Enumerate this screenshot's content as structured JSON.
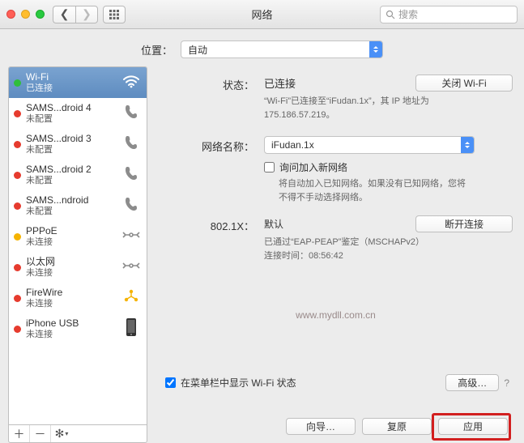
{
  "window": {
    "title": "网络"
  },
  "search": {
    "placeholder": "搜索"
  },
  "location": {
    "label": "位置：",
    "value": "自动"
  },
  "sidebar": {
    "items": [
      {
        "name": "Wi-Fi",
        "status": "已连接",
        "dot": "green",
        "icon": "wifi",
        "selected": true
      },
      {
        "name": "SAMS...droid 4",
        "status": "未配置",
        "dot": "red",
        "icon": "phone"
      },
      {
        "name": "SAMS...droid 3",
        "status": "未配置",
        "dot": "red",
        "icon": "phone"
      },
      {
        "name": "SAMS...droid 2",
        "status": "未配置",
        "dot": "red",
        "icon": "phone"
      },
      {
        "name": "SAMS...ndroid",
        "status": "未配置",
        "dot": "red",
        "icon": "phone"
      },
      {
        "name": "PPPoE",
        "status": "未连接",
        "dot": "yellow",
        "icon": "ethernet"
      },
      {
        "name": "以太网",
        "status": "未连接",
        "dot": "red",
        "icon": "ethernet"
      },
      {
        "name": "FireWire",
        "status": "未连接",
        "dot": "red",
        "icon": "firewire"
      },
      {
        "name": "iPhone USB",
        "status": "未连接",
        "dot": "red",
        "icon": "iphone"
      }
    ]
  },
  "detail": {
    "status_label": "状态：",
    "status_value": "已连接",
    "turn_off": "关闭 Wi-Fi",
    "status_desc": "“Wi-Fi”已连接至“iFudan.1x”，其 IP 地址为 175.186.57.219。",
    "netname_label": "网络名称：",
    "netname_value": "iFudan.1x",
    "ask_join": "询问加入新网络",
    "ask_join_desc": "将自动加入已知网络。如果没有已知网络，您将不得不手动选择网络。",
    "dot1x_label": "802.1X：",
    "dot1x_value": "默认",
    "disconnect": "断开连接",
    "dot1x_desc1": "已通过“EAP-PEAP”鉴定（MSCHAPv2）",
    "dot1x_desc2": "连接时间：08:56:42",
    "watermark": "www.mydll.com.cn",
    "show_in_menu": "在菜单栏中显示 Wi-Fi 状态",
    "advanced": "高级…",
    "assist": "向导…",
    "revert": "复原",
    "apply": "应用"
  }
}
